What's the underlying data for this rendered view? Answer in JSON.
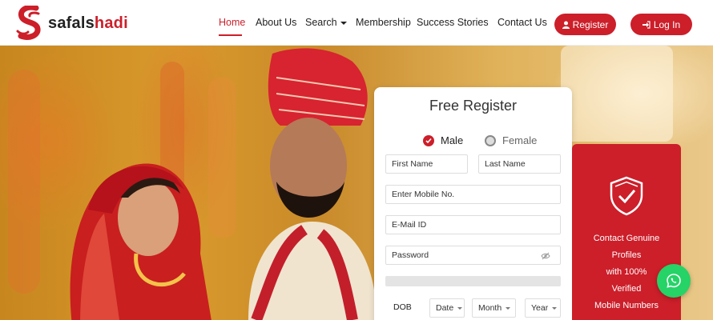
{
  "brand": {
    "name_part1": "safals",
    "name_part2": "hadi"
  },
  "nav": {
    "items": [
      "Home",
      "About Us",
      "Search",
      "Membership",
      "Success Stories",
      "Contact Us"
    ],
    "active": "Home",
    "register_label": "Register",
    "login_label": "Log In"
  },
  "register": {
    "title": "Free Register",
    "gender_options": [
      "Male",
      "Female"
    ],
    "gender_selected": "Male",
    "first_name_placeholder": "First Name",
    "last_name_placeholder": "Last Name",
    "mobile_placeholder": "Enter Mobile No.",
    "email_placeholder": "E-Mail ID",
    "password_placeholder": "Password",
    "dob_label": "DOB",
    "date_label": "Date",
    "month_label": "Month",
    "year_label": "Year"
  },
  "side_panel": {
    "lines": [
      "Contact Genuine",
      "Profiles",
      "with 100%",
      "Verified",
      "Mobile Numbers"
    ]
  },
  "colors": {
    "brand_red": "#cc1f2a",
    "whatsapp_green": "#25d366"
  },
  "icons": [
    "user-icon",
    "login-icon",
    "shield-check-icon",
    "eye-slash-icon",
    "whatsapp-icon",
    "caret-down-icon"
  ]
}
